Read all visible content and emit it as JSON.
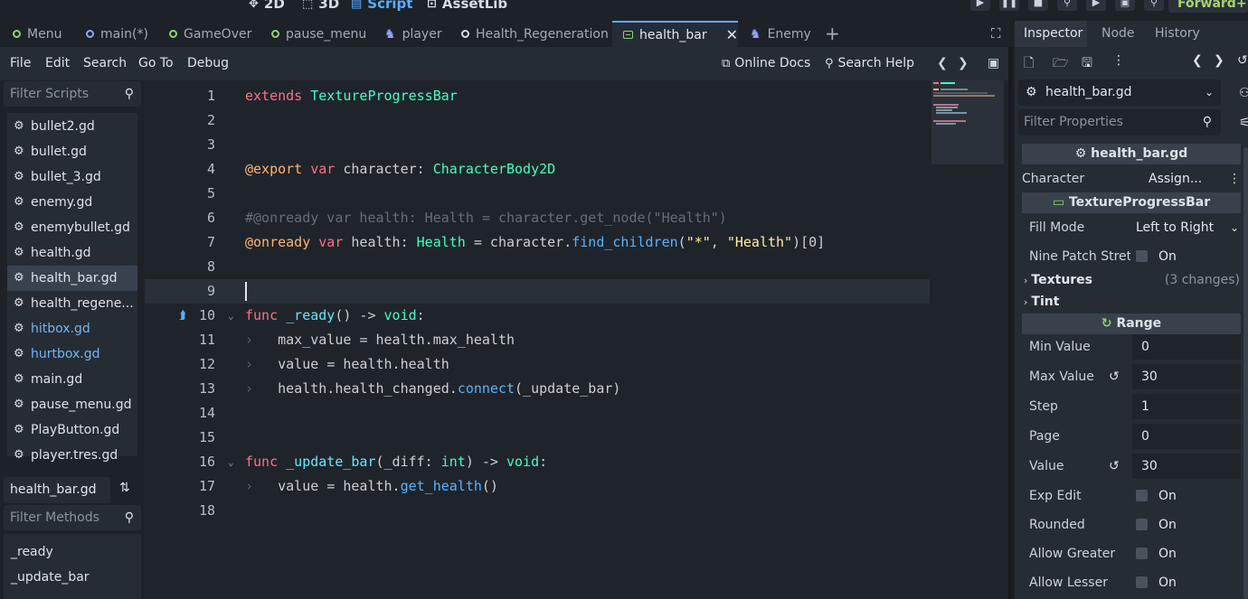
{
  "top_modes": [
    {
      "label": "2D",
      "icon": "move-icon"
    },
    {
      "label": "3D",
      "icon": "cube-icon"
    },
    {
      "label": "Script",
      "icon": "script-icon"
    },
    {
      "label": "AssetLib",
      "icon": "assetlib-icon"
    }
  ],
  "renderer": "Forward+",
  "editor_tabs": [
    {
      "label": "Menu",
      "icon": "scene-icon"
    },
    {
      "label": "main(*)",
      "icon": "scene-icon"
    },
    {
      "label": "GameOver",
      "icon": "scene-icon"
    },
    {
      "label": "pause_menu",
      "icon": "scene-icon"
    },
    {
      "label": "player",
      "icon": "character-icon"
    },
    {
      "label": "Health_Regeneration",
      "icon": "node-icon"
    },
    {
      "label": "health_bar",
      "icon": "texture-progress-icon"
    },
    {
      "label": "Enemy",
      "icon": "character-icon"
    }
  ],
  "menu": {
    "file": "File",
    "edit": "Edit",
    "search": "Search",
    "goto": "Go To",
    "debug": "Debug",
    "online_docs": "Online Docs",
    "search_help": "Search Help"
  },
  "scripts": {
    "filter_placeholder": "Filter Scripts",
    "items": [
      {
        "name": "bullet2.gd"
      },
      {
        "name": "bullet.gd"
      },
      {
        "name": "bullet_3.gd"
      },
      {
        "name": "enemy.gd"
      },
      {
        "name": "enemybullet.gd"
      },
      {
        "name": "health.gd"
      },
      {
        "name": "health_bar.gd"
      },
      {
        "name": "health_regene..."
      },
      {
        "name": "hitbox.gd"
      },
      {
        "name": "hurtbox.gd"
      },
      {
        "name": "main.gd"
      },
      {
        "name": "pause_menu.gd"
      },
      {
        "name": "PlayButton.gd"
      },
      {
        "name": "player.tres.gd"
      }
    ],
    "current_file": "health_bar.gd",
    "methods_placeholder": "Filter Methods",
    "methods": [
      "_ready",
      "_update_bar"
    ]
  },
  "code": {
    "line_numbers": [
      "1",
      "2",
      "3",
      "4",
      "5",
      "6",
      "7",
      "8",
      "9",
      "10",
      "11",
      "12",
      "13",
      "14",
      "15",
      "16",
      "17",
      "18"
    ],
    "l1": {
      "kw": "extends",
      "type": "TextureProgressBar"
    },
    "l4": {
      "annot": "@export",
      "kw": "var",
      "rest": "character:",
      "type": "CharacterBody2D"
    },
    "l6": {
      "comment": "#@onready var health: Health = character.get_node(\"Health\")"
    },
    "l7": {
      "annot": "@onready",
      "kw": "var",
      "a": "health:",
      "type": "Health",
      "b": "= character.",
      "fn": "find_children",
      "c": "(",
      "s1": "\"*\"",
      "d": ",",
      "s2": "\"Health\"",
      "e": ")[0]"
    },
    "l10": {
      "kw": "func",
      "fn": "_ready",
      "a": "() ->",
      "type": "void",
      "b": ":"
    },
    "l11": {
      "a": "max_value",
      "b": "= health.max_health"
    },
    "l12": {
      "a": "value",
      "b": "= health.health"
    },
    "l13": {
      "a": "health.health_changed.",
      "fn": "connect",
      "b": "(_update_bar)"
    },
    "l16": {
      "kw": "func",
      "fn": "_update_bar",
      "a": "(_diff:",
      "type": "int",
      "b": ") ->",
      "type2": "void",
      "c": ":"
    },
    "l17": {
      "a": "value",
      "b": "= health.",
      "fn": "get_health",
      "c": "()"
    }
  },
  "inspector": {
    "tabs": [
      "Inspector",
      "Node",
      "History"
    ],
    "resource": "health_bar.gd",
    "filter_placeholder": "Filter Properties",
    "script_section": "health_bar.gd",
    "character_label": "Character",
    "character_value": "Assign...",
    "class_section": "TextureProgressBar",
    "fill_mode_label": "Fill Mode",
    "fill_mode_value": "Left to Right",
    "nine_patch_label": "Nine Patch Stret",
    "on_text": "On",
    "textures_label": "Textures",
    "textures_changes": "(3 changes)",
    "tint_label": "Tint",
    "range_section": "Range",
    "min_value_label": "Min Value",
    "min_value": "0",
    "max_value_label": "Max Value",
    "max_value": "30",
    "step_label": "Step",
    "step": "1",
    "page_label": "Page",
    "page": "0",
    "value_label": "Value",
    "value": "30",
    "exp_edit_label": "Exp Edit",
    "rounded_label": "Rounded",
    "allow_greater_label": "Allow Greater",
    "allow_lesser_label": "Allow Lesser"
  },
  "colors": {
    "accent": "#5aaeff",
    "keyword": "#ff7085",
    "type": "#42ffc2",
    "annotation": "#ffb373"
  }
}
